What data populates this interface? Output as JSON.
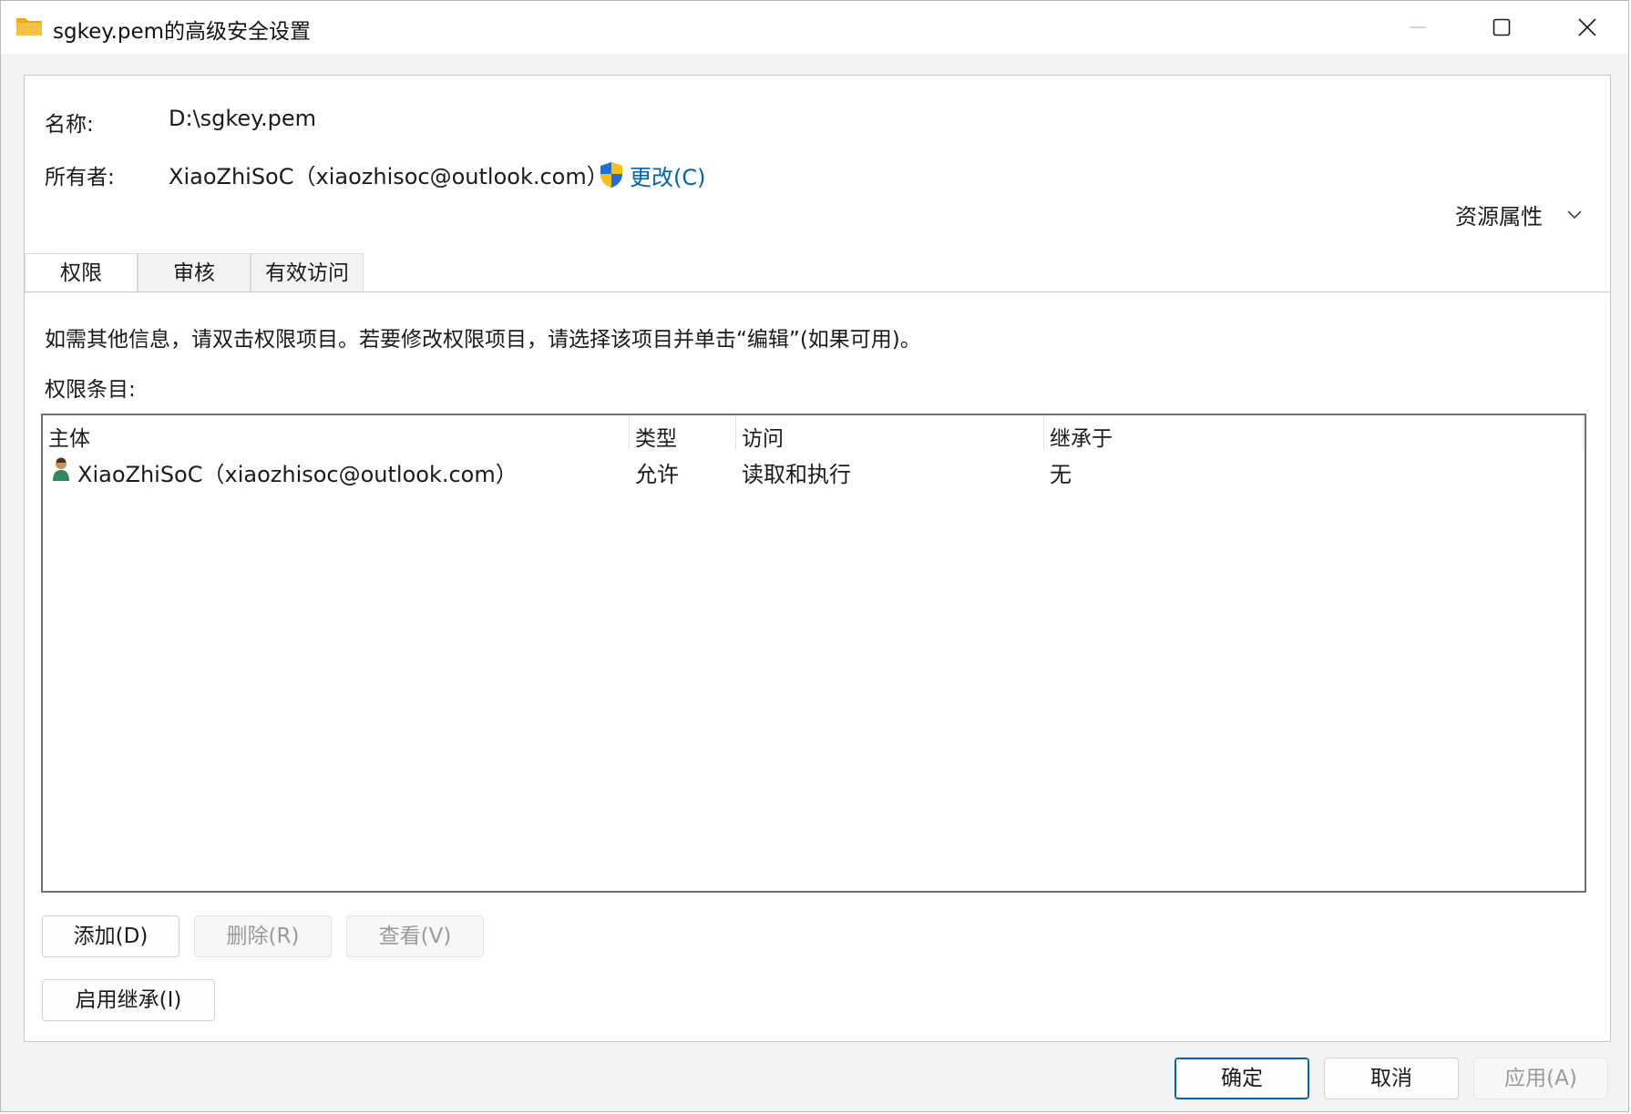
{
  "window": {
    "title": "sgkey.pem的高级安全设置",
    "folder_color": "#f6c142"
  },
  "header": {
    "name_label": "名称:",
    "name_value": "D:\\sgkey.pem",
    "owner_label": "所有者:",
    "owner_value": "XiaoZhiSoC（xiaozhisoc@outlook.com）",
    "change_link": "更改(C)",
    "resource_props": "资源属性"
  },
  "tabs": [
    {
      "label": "权限",
      "active": true
    },
    {
      "label": "审核",
      "active": false
    },
    {
      "label": "有效访问",
      "active": false
    }
  ],
  "info_text": "如需其他信息，请双击权限项目。若要修改权限项目，请选择该项目并单击“编辑”(如果可用)。",
  "entries_label": "权限条目:",
  "table": {
    "columns": [
      "主体",
      "类型",
      "访问",
      "继承于"
    ],
    "rows": [
      {
        "principal": "XiaoZhiSoC（xiaozhisoc@outlook.com）",
        "type": "允许",
        "access": "读取和执行",
        "inherited_from": "无"
      }
    ]
  },
  "buttons": {
    "add": "添加(D)",
    "remove": "删除(R)",
    "view": "查看(V)",
    "enable_inheritance": "启用继承(I)",
    "ok": "确定",
    "cancel": "取消",
    "apply": "应用(A)"
  },
  "colors": {
    "link": "#0063b1",
    "primary_border": "#0063b1",
    "shield_blue": "#1f6fd6",
    "shield_yellow": "#f4c20d"
  }
}
